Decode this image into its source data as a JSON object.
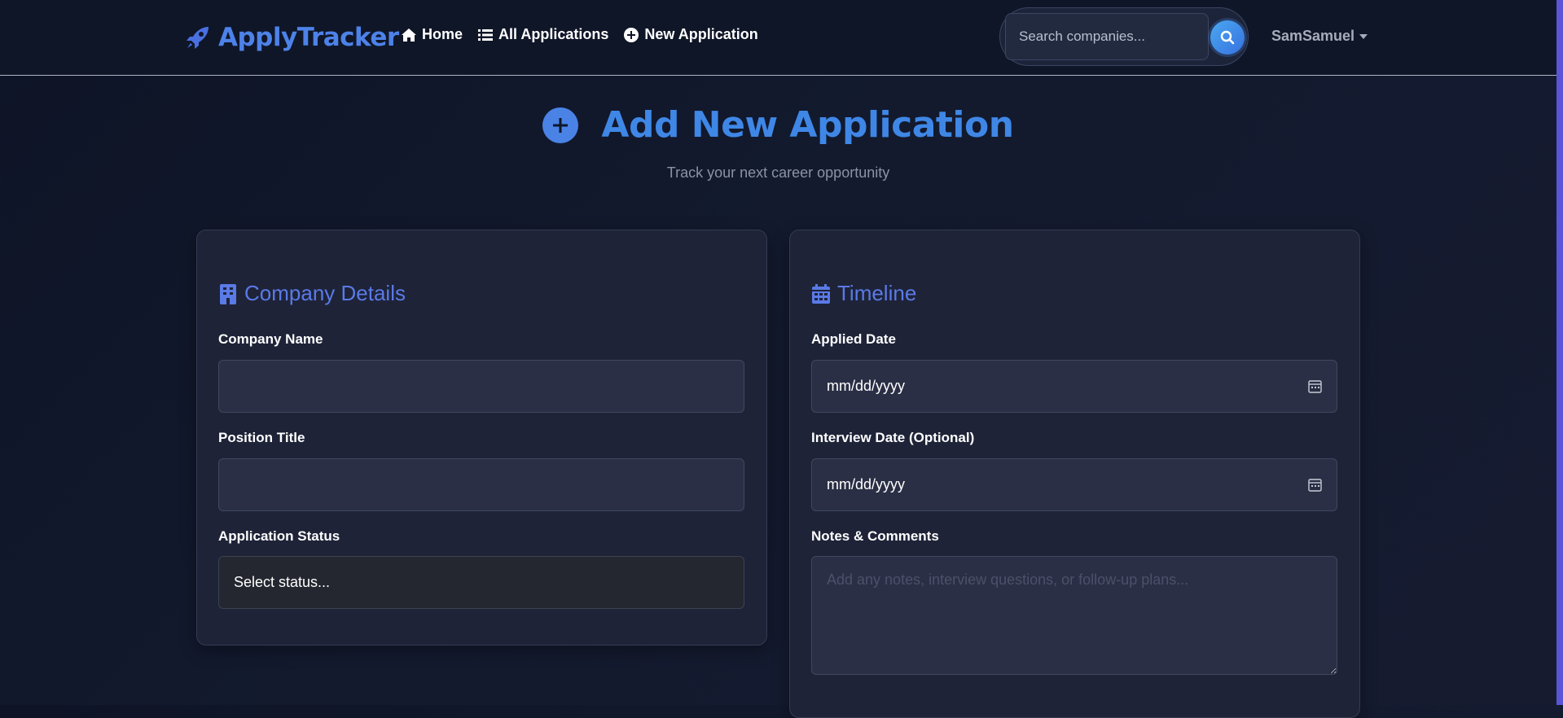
{
  "navbar": {
    "brand": "ApplyTracker",
    "links": [
      {
        "label": "Home",
        "icon": "home-icon"
      },
      {
        "label": "All Applications",
        "icon": "list-icon"
      },
      {
        "label": "New Application",
        "icon": "plus-circle-icon"
      }
    ],
    "search_placeholder": "Search companies...",
    "user": "SamSamuel"
  },
  "header": {
    "title": "Add New Application",
    "subtitle": "Track your next career opportunity"
  },
  "company_card": {
    "title": "Company Details",
    "company_name_label": "Company Name",
    "company_name_value": "",
    "position_label": "Position Title",
    "position_value": "",
    "status_label": "Application Status",
    "status_value": "Select status..."
  },
  "timeline_card": {
    "title": "Timeline",
    "applied_label": "Applied Date",
    "applied_value": "mm/dd/yyyy",
    "interview_label": "Interview Date (Optional)",
    "interview_value": "mm/dd/yyyy",
    "notes_label": "Notes & Comments",
    "notes_placeholder": "Add any notes, interview questions, or follow-up plans..."
  },
  "colors": {
    "accent": "#4d82e8",
    "card_bg": "#1e2338",
    "page_bg": "#131a2e",
    "scrollbar": "#5b54d6"
  }
}
